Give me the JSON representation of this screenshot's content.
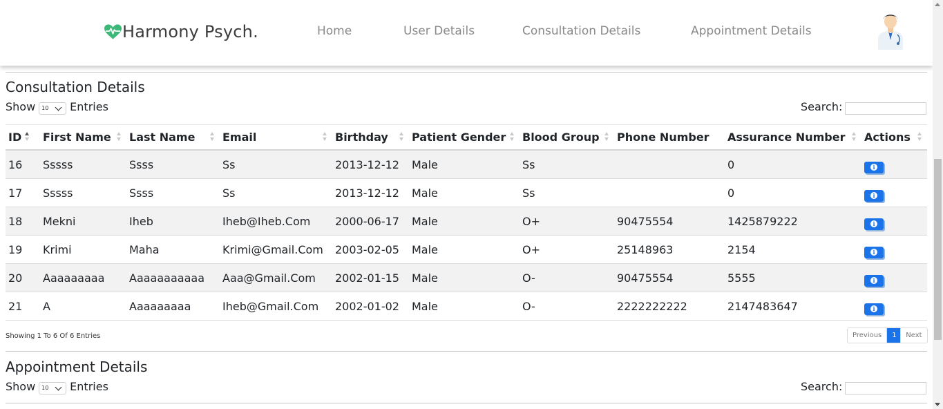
{
  "header": {
    "brand": "Harmony Psych.",
    "nav": [
      "Home",
      "User Details",
      "Consultation Details",
      "Appointment Details"
    ]
  },
  "consultation": {
    "title": "Consultation Details",
    "show_label": "Show",
    "entries_label": "Entries",
    "page_size": "10",
    "search_label": "Search:",
    "search_value": "",
    "columns": [
      "ID",
      "First Name",
      "Last Name",
      "Email",
      "Birthday",
      "Patient Gender",
      "Blood Group",
      "Phone Number",
      "Assurance Number",
      "Actions"
    ],
    "rows": [
      [
        "16",
        "Sssss",
        "Ssss",
        "Ss",
        "2013-12-12",
        "Male",
        "Ss",
        "",
        "0"
      ],
      [
        "17",
        "Sssss",
        "Ssss",
        "Ss",
        "2013-12-12",
        "Male",
        "Ss",
        "",
        "0"
      ],
      [
        "18",
        "Mekni",
        "Iheb",
        "Iheb@Iheb.Com",
        "2000-06-17",
        "Male",
        "O+",
        "90475554",
        "1425879222"
      ],
      [
        "19",
        "Krimi",
        "Maha",
        "Krimi@Gmail.Com",
        "2003-02-05",
        "Male",
        "O+",
        "25148963",
        "2154"
      ],
      [
        "20",
        "Aaaaaaaaa",
        "Aaaaaaaaaaa",
        "Aaa@Gmail.Com",
        "2002-01-15",
        "Male",
        "O-",
        "90475554",
        "5555"
      ],
      [
        "21",
        "A",
        "Aaaaaaaaa",
        "Iheb@Gmail.Com",
        "2002-01-02",
        "Male",
        "O-",
        "2222222222",
        "2147483647"
      ]
    ],
    "info": "Showing 1 To 6 Of 6 Entries",
    "pagination": {
      "previous": "Previous",
      "current": "1",
      "next": "Next"
    }
  },
  "appointment": {
    "title": "Appointment Details",
    "show_label": "Show",
    "entries_label": "Entries",
    "page_size": "10",
    "search_label": "Search:",
    "search_value": ""
  },
  "colors": {
    "accent": "#1a73e8",
    "logo_green": "#3cb878"
  },
  "icons": {
    "logo": "heartbeat-icon",
    "avatar": "doctor-avatar",
    "action": "info-icon"
  }
}
